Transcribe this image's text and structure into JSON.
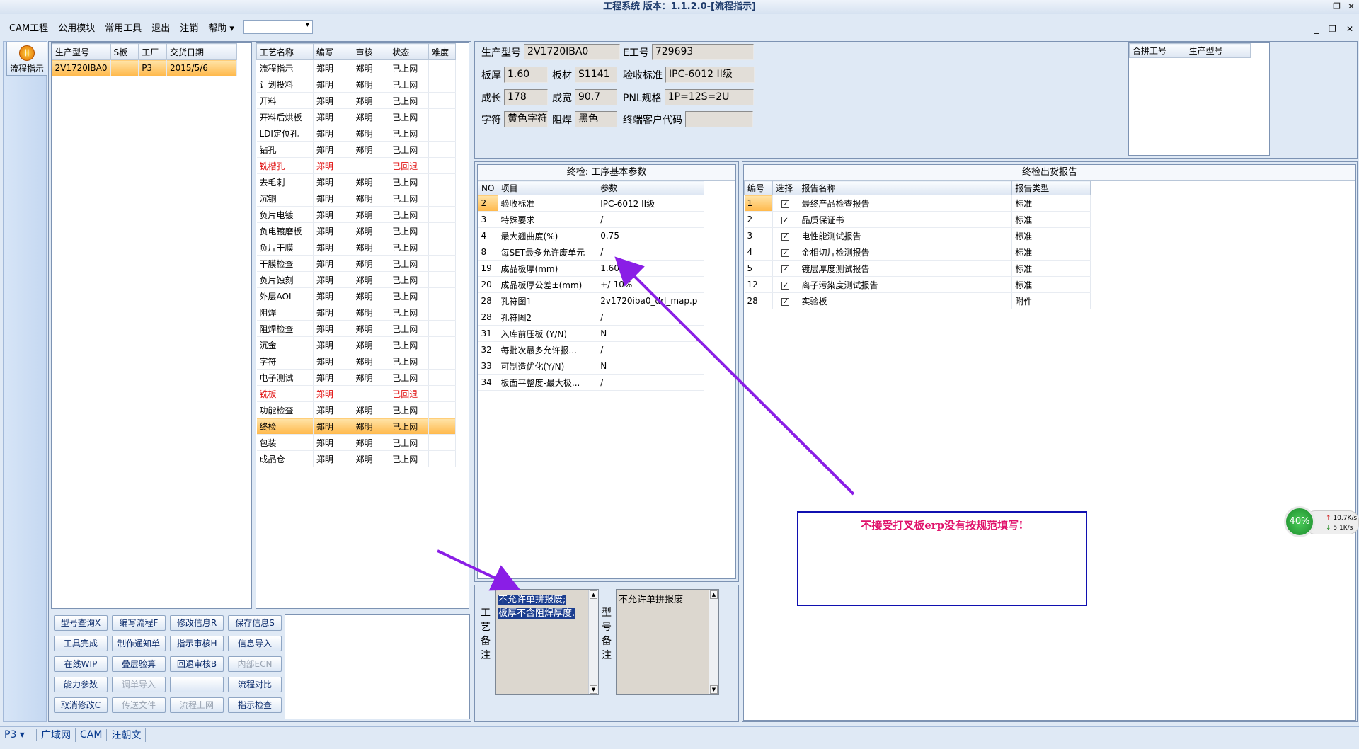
{
  "window": {
    "title": "工程系统 版本：1.1.2.0-[流程指示]",
    "controls": [
      "_",
      "❐",
      "✕"
    ],
    "mdi_controls": [
      "_",
      "❐",
      "✕"
    ]
  },
  "menu": [
    "CAM工程",
    "公用模块",
    "常用工具",
    "退出",
    "注销",
    "帮助 ▾"
  ],
  "menu_combo_value": "",
  "left_toolbar": {
    "flow_button_label": "流程指示",
    "flow_icon_text": "||"
  },
  "model_table": {
    "headers": [
      "生产型号",
      "S板",
      "工厂",
      "交货日期"
    ],
    "rows": [
      [
        "2V1720IBA0",
        "",
        "P3",
        "2015/5/6"
      ]
    ]
  },
  "process_table": {
    "headers": [
      "工艺名称",
      "编写",
      "审核",
      "状态",
      "难度"
    ],
    "rows": [
      {
        "name": "流程指示",
        "w": "郑明",
        "a": "郑明",
        "s": "已上网",
        "d": "",
        "red": false
      },
      {
        "name": "计划投料",
        "w": "郑明",
        "a": "郑明",
        "s": "已上网",
        "d": "",
        "red": false
      },
      {
        "name": "开料",
        "w": "郑明",
        "a": "郑明",
        "s": "已上网",
        "d": "",
        "red": false
      },
      {
        "name": "开料后烘板",
        "w": "郑明",
        "a": "郑明",
        "s": "已上网",
        "d": "",
        "red": false
      },
      {
        "name": "LDI定位孔",
        "w": "郑明",
        "a": "郑明",
        "s": "已上网",
        "d": "",
        "red": false
      },
      {
        "name": "钻孔",
        "w": "郑明",
        "a": "郑明",
        "s": "已上网",
        "d": "",
        "red": false
      },
      {
        "name": "铣槽孔",
        "w": "郑明",
        "a": "",
        "s": "已回退",
        "d": "",
        "red": true
      },
      {
        "name": "去毛刺",
        "w": "郑明",
        "a": "郑明",
        "s": "已上网",
        "d": "",
        "red": false
      },
      {
        "name": "沉铜",
        "w": "郑明",
        "a": "郑明",
        "s": "已上网",
        "d": "",
        "red": false
      },
      {
        "name": "负片电镀",
        "w": "郑明",
        "a": "郑明",
        "s": "已上网",
        "d": "",
        "red": false
      },
      {
        "name": "负电镀磨板",
        "w": "郑明",
        "a": "郑明",
        "s": "已上网",
        "d": "",
        "red": false
      },
      {
        "name": "负片干膜",
        "w": "郑明",
        "a": "郑明",
        "s": "已上网",
        "d": "",
        "red": false
      },
      {
        "name": "干膜检查",
        "w": "郑明",
        "a": "郑明",
        "s": "已上网",
        "d": "",
        "red": false
      },
      {
        "name": "负片蚀刻",
        "w": "郑明",
        "a": "郑明",
        "s": "已上网",
        "d": "",
        "red": false
      },
      {
        "name": "外层AOI",
        "w": "郑明",
        "a": "郑明",
        "s": "已上网",
        "d": "",
        "red": false
      },
      {
        "name": "阻焊",
        "w": "郑明",
        "a": "郑明",
        "s": "已上网",
        "d": "",
        "red": false
      },
      {
        "name": "阻焊检查",
        "w": "郑明",
        "a": "郑明",
        "s": "已上网",
        "d": "",
        "red": false
      },
      {
        "name": "沉金",
        "w": "郑明",
        "a": "郑明",
        "s": "已上网",
        "d": "",
        "red": false
      },
      {
        "name": "字符",
        "w": "郑明",
        "a": "郑明",
        "s": "已上网",
        "d": "",
        "red": false
      },
      {
        "name": "电子测试",
        "w": "郑明",
        "a": "郑明",
        "s": "已上网",
        "d": "",
        "red": false
      },
      {
        "name": "铣板",
        "w": "郑明",
        "a": "",
        "s": "已回退",
        "d": "",
        "red": true
      },
      {
        "name": "功能检查",
        "w": "郑明",
        "a": "郑明",
        "s": "已上网",
        "d": "",
        "red": false
      },
      {
        "name": "终检",
        "w": "郑明",
        "a": "郑明",
        "s": "已上网",
        "d": "",
        "red": false,
        "sel": true
      },
      {
        "name": "包装",
        "w": "郑明",
        "a": "郑明",
        "s": "已上网",
        "d": "",
        "red": false
      },
      {
        "name": "成品仓",
        "w": "郑明",
        "a": "郑明",
        "s": "已上网",
        "d": "",
        "red": false
      }
    ]
  },
  "buttons": [
    {
      "label": "型号查询X",
      "enabled": true
    },
    {
      "label": "编写流程F",
      "enabled": true
    },
    {
      "label": "修改信息R",
      "enabled": true
    },
    {
      "label": "保存信息S",
      "enabled": true
    },
    {
      "label": "工具完成",
      "enabled": true
    },
    {
      "label": "制作通知单",
      "enabled": true
    },
    {
      "label": "指示审核H",
      "enabled": true
    },
    {
      "label": "信息导入",
      "enabled": true
    },
    {
      "label": "在线WIP",
      "enabled": true
    },
    {
      "label": "叠层验算",
      "enabled": true
    },
    {
      "label": "回退审核B",
      "enabled": true
    },
    {
      "label": "内部ECN",
      "enabled": false
    },
    {
      "label": "能力参数",
      "enabled": true
    },
    {
      "label": "调单导入",
      "enabled": false
    },
    {
      "label": "",
      "enabled": false
    },
    {
      "label": "流程对比",
      "enabled": true
    },
    {
      "label": "取消修改C",
      "enabled": true
    },
    {
      "label": "传送文件",
      "enabled": false
    },
    {
      "label": "流程上网",
      "enabled": false
    },
    {
      "label": "指示检查",
      "enabled": true
    }
  ],
  "header_fields": {
    "prod_model_label": "生产型号",
    "prod_model": "2V1720IBA0",
    "e_no_label": "E工号",
    "e_no": "729693",
    "thickness_label": "板厚",
    "thickness": "1.60",
    "material_label": "板材",
    "material": "S1141",
    "std_label": "验收标准",
    "std": "IPC-6012 II级",
    "len_label": "成长",
    "len": "178",
    "width_label": "成宽",
    "width": "90.7",
    "pnl_label": "PNL规格",
    "pnl": "1P=12S=2U",
    "char_label": "字符",
    "char": "黄色字符",
    "mask_label": "阻焊",
    "mask": "黑色",
    "cust_label": "终端客户代码",
    "cust": ""
  },
  "merge_table": {
    "headers": [
      "合拼工号",
      "生产型号"
    ]
  },
  "param_panel": {
    "title": "终检: 工序基本参数",
    "headers": [
      "NO",
      "项目",
      "参数"
    ],
    "rows": [
      [
        "2",
        "验收标准",
        "IPC-6012 II级"
      ],
      [
        "3",
        "特殊要求",
        "/"
      ],
      [
        "4",
        "最大翘曲度(%)",
        "0.75"
      ],
      [
        "8",
        "每SET最多允许废单元",
        "/"
      ],
      [
        "19",
        "成品板厚(mm)",
        "1.60"
      ],
      [
        "20",
        "成品板厚公差±(mm)",
        "+/-10%"
      ],
      [
        "28",
        "孔符图1",
        "2v1720iba0_drl_map.p"
      ],
      [
        "28",
        "孔符图2",
        "/"
      ],
      [
        "31",
        "入库前压板 (Y/N)",
        "N"
      ],
      [
        "32",
        "每批次最多允许报...",
        "/"
      ],
      [
        "33",
        "可制造优化(Y/N)",
        "N"
      ],
      [
        "34",
        "板面平整度-最大极...",
        "/"
      ]
    ]
  },
  "report_panel": {
    "title": "终检出货报告",
    "headers": [
      "编号",
      "选择",
      "报告名称",
      "报告类型"
    ],
    "rows": [
      [
        "1",
        "✓",
        "最终产品检查报告",
        "标准"
      ],
      [
        "2",
        "✓",
        "品质保证书",
        "标准"
      ],
      [
        "3",
        "✓",
        "电性能测试报告",
        "标准"
      ],
      [
        "4",
        "✓",
        "金相切片检测报告",
        "标准"
      ],
      [
        "5",
        "✓",
        "镀层厚度测试报告",
        "标准"
      ],
      [
        "12",
        "✓",
        "离子污染度测试报告",
        "标准"
      ],
      [
        "28",
        "✓",
        "实验板",
        "附件"
      ]
    ]
  },
  "remarks": {
    "process_label": "工艺备注",
    "process_lines": [
      "不允许单拼报废;",
      "板厚不含阻焊厚度."
    ],
    "model_label": "型号备注",
    "model_text": "不允许单拼报废"
  },
  "notice": "不接受打叉板erp没有按规范填写!",
  "net_widget": {
    "percent": "40%",
    "up": "10.7K/s",
    "down": "5.1K/s"
  },
  "status_bar": [
    "P3 ▾",
    "广域网",
    "CAM",
    "汪朝文"
  ],
  "colors": {
    "accent": "#ffb84a",
    "annotation": "#8a1ee6",
    "notice_border": "#1010b0",
    "notice_text": "#e0106a"
  }
}
